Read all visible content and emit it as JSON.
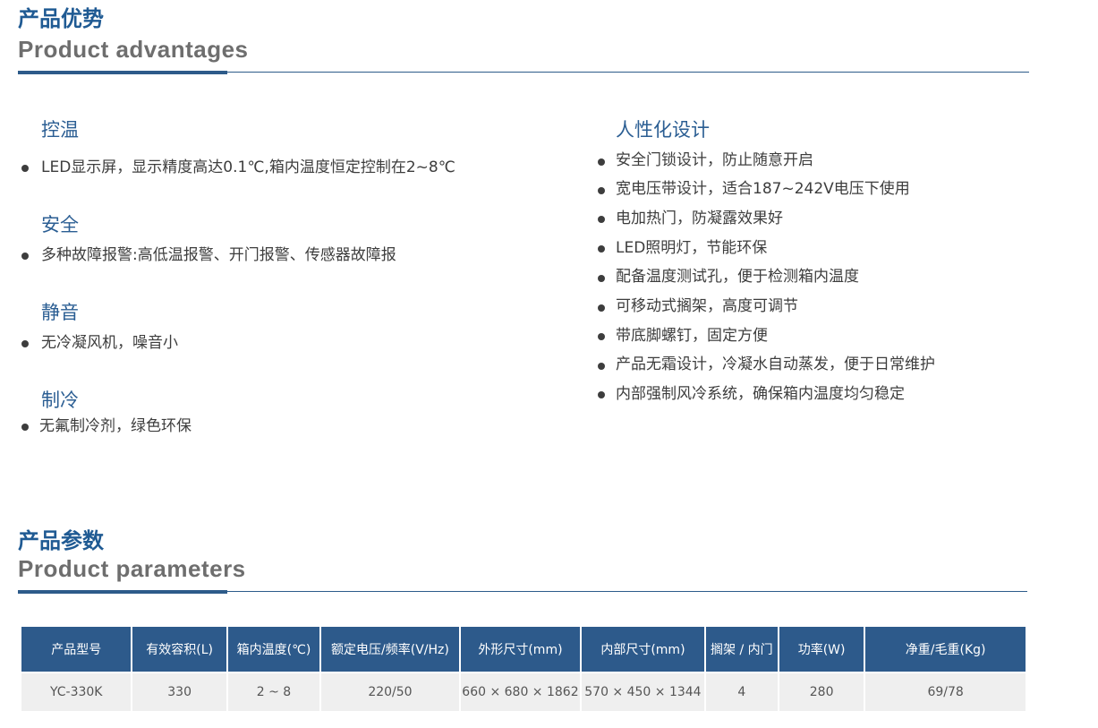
{
  "advantages": {
    "title_cn": "产品优势",
    "title_en": "Product advantages",
    "left_groups": [
      {
        "heading": "控温",
        "items": [
          "LED显示屏，显示精度高达0.1℃,箱内温度恒定控制在2~8℃"
        ]
      },
      {
        "heading": "安全",
        "items": [
          "多种故障报警:高低温报警、开门报警、传感器故障报"
        ]
      },
      {
        "heading": "静音",
        "items": [
          "无冷凝风机，噪音小"
        ]
      },
      {
        "heading": "制冷",
        "items": [
          "无氟制冷剂，绿色环保"
        ]
      }
    ],
    "right_group": {
      "heading": "人性化设计",
      "items": [
        "安全门锁设计，防止随意开启",
        "宽电压带设计，适合187~242V电压下使用",
        "电加热门，防凝露效果好",
        "LED照明灯，节能环保",
        "配备温度测试孔，便于检测箱内温度",
        "可移动式搁架，高度可调节",
        "带底脚螺钉，固定方便",
        "产品无霜设计，冷凝水自动蒸发，便于日常维护",
        "内部强制风冷系统，确保箱内温度均匀稳定"
      ]
    }
  },
  "parameters": {
    "title_cn": "产品参数",
    "title_en": "Product parameters",
    "headers": [
      "产品型号",
      "有效容积(L)",
      "箱内温度(℃)",
      "额定电压/频率(V/Hz)",
      "外形尺寸(mm)",
      "内部尺寸(mm)",
      "搁架 / 内门",
      "功率(W)",
      "净重/毛重(Kg)"
    ],
    "rows": [
      [
        "YC-330K",
        "330",
        "2 ~ 8",
        "220/50",
        "660 × 680 × 1862",
        "570 × 450 × 1344",
        "4",
        "280",
        "69/78"
      ]
    ]
  },
  "colors": {
    "brand_blue": "#1f5a93",
    "table_header": "#2d5a8b",
    "table_row": "#efefef"
  }
}
